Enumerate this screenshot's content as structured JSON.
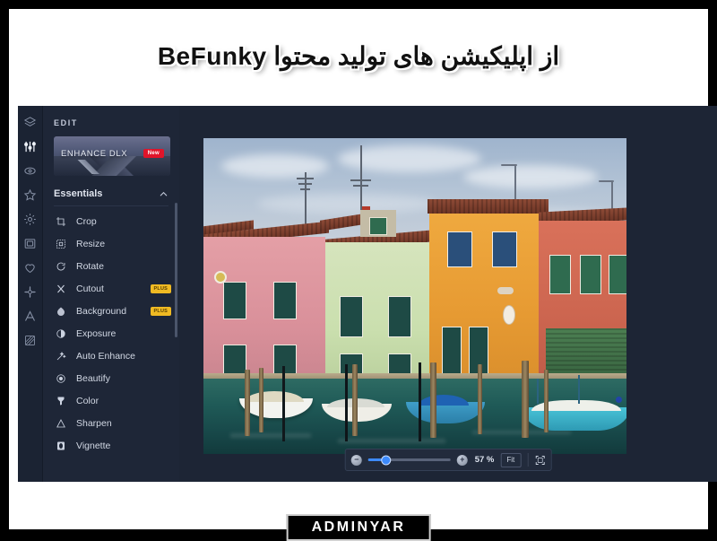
{
  "headline": "از اپلیکیشن های تولید محتوا BeFunky",
  "watermark": {
    "text": "ADMINYAR"
  },
  "app": {
    "rail": [
      {
        "name": "layers-icon",
        "label": "Layers"
      },
      {
        "name": "sliders-icon",
        "label": "Edit"
      },
      {
        "name": "eye-icon",
        "label": "Touch Up"
      },
      {
        "name": "star-icon",
        "label": "Effects"
      },
      {
        "name": "gear-icon",
        "label": "Settings"
      },
      {
        "name": "frame-icon",
        "label": "Frames"
      },
      {
        "name": "heart-icon",
        "label": "Overlays"
      },
      {
        "name": "flower-icon",
        "label": "Graphics"
      },
      {
        "name": "text-icon",
        "label": "Text"
      },
      {
        "name": "texture-icon",
        "label": "Textures"
      }
    ],
    "panel": {
      "edit_label": "EDIT",
      "promo": {
        "title": "ENHANCE DLX",
        "badge": "New"
      },
      "section": {
        "title": "Essentials",
        "chevron": "chevron-up-icon"
      },
      "items": [
        {
          "label": "Crop",
          "icon": "crop-icon",
          "badge": ""
        },
        {
          "label": "Resize",
          "icon": "resize-icon",
          "badge": ""
        },
        {
          "label": "Rotate",
          "icon": "rotate-icon",
          "badge": ""
        },
        {
          "label": "Cutout",
          "icon": "cutout-icon",
          "badge": "PLUS"
        },
        {
          "label": "Background",
          "icon": "background-icon",
          "badge": "PLUS"
        },
        {
          "label": "Exposure",
          "icon": "exposure-icon",
          "badge": ""
        },
        {
          "label": "Auto Enhance",
          "icon": "magic-wand-icon",
          "badge": ""
        },
        {
          "label": "Beautify",
          "icon": "beautify-icon",
          "badge": ""
        },
        {
          "label": "Color",
          "icon": "color-icon",
          "badge": ""
        },
        {
          "label": "Sharpen",
          "icon": "sharpen-icon",
          "badge": ""
        },
        {
          "label": "Vignette",
          "icon": "vignette-icon",
          "badge": ""
        }
      ]
    },
    "zoombar": {
      "zoom_out": "−",
      "zoom_in": "+",
      "value": "57 %",
      "fit_label": "Fit",
      "fullscreen_icon": "fullscreen-icon",
      "slider_percent": 22
    },
    "photo": {
      "alt": "Colorful houses along a canal with moored boats, Burano Venice"
    }
  },
  "colors": {
    "app_bg": "#1d2535",
    "panel_bg": "#1e2637",
    "accent_blue": "#3d8bfd",
    "badge_plus": "#f0ba23",
    "badge_new": "#e0142a"
  }
}
